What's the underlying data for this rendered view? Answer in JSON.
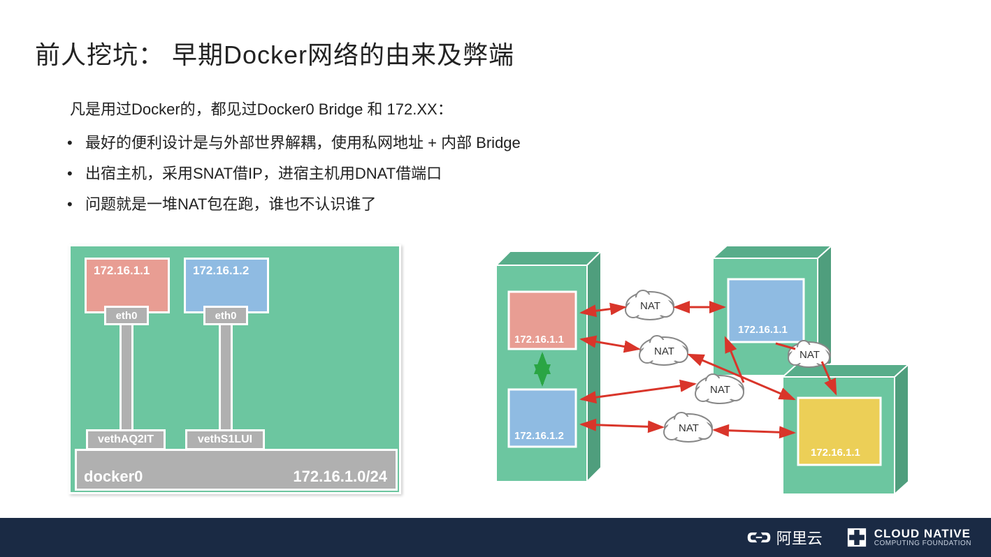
{
  "title": "前人挖坑： 早期Docker网络的由来及弊端",
  "intro": "凡是用过Docker的，都见过Docker0 Bridge 和 172.XX：",
  "bullets": [
    "最好的便利设计是与外部世界解耦，使用私网地址 + 内部  Bridge",
    "出宿主机，采用SNAT借IP，进宿主机用DNAT借端口",
    "问题就是一堆NAT包在跑，谁也不认识谁了"
  ],
  "left_diagram": {
    "container1_ip": "172.16.1.1",
    "container2_ip": "172.16.1.2",
    "eth_label": "eth0",
    "veth1": "vethAQ2IT",
    "veth2": "vethS1LUI",
    "bridge_name": "docker0",
    "bridge_cidr": "172.16.1.0/24"
  },
  "right_diagram": {
    "host1_box1": "172.16.1.1",
    "host1_box2": "172.16.1.2",
    "host2_box": "172.16.1.1",
    "host3_box": "172.16.1.1",
    "nat_label": "NAT"
  },
  "footer": {
    "aliyun": "阿里云",
    "cncf_line1": "CLOUD NATIVE",
    "cncf_line2": "COMPUTING FOUNDATION"
  }
}
